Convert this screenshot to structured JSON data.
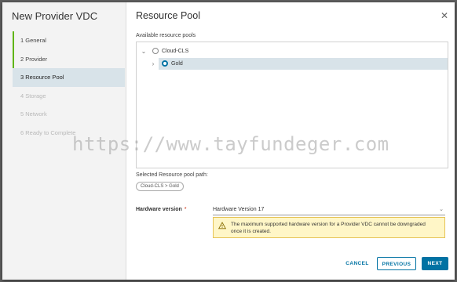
{
  "wizard": {
    "title": "New Provider VDC",
    "steps": [
      {
        "label": "1  General"
      },
      {
        "label": "2  Provider"
      },
      {
        "label": "3  Resource Pool"
      },
      {
        "label": "4  Storage"
      },
      {
        "label": "5  Network"
      },
      {
        "label": "6  Ready to Complete"
      }
    ]
  },
  "page": {
    "title": "Resource Pool",
    "available_label": "Available resource pools",
    "tree": [
      {
        "name": "Cloud-CLS"
      },
      {
        "name": "Gold"
      }
    ],
    "selected_path_label": "Selected Resource pool path:",
    "selected_path": "Cloud-CLS > Gold",
    "hardware_label": "Hardware version",
    "required_mark": "*",
    "hardware_value": "Hardware Version 17",
    "warning": "The maximum supported hardware version for a Provider VDC cannot be downgraded once it is created."
  },
  "buttons": {
    "cancel": "CANCEL",
    "previous": "PREVIOUS",
    "next": "NEXT"
  },
  "watermark": "https://www.tayfundeger.com",
  "colors": {
    "accent": "#0072a3",
    "done": "#60b515",
    "warning_bg": "#fff6c7"
  }
}
